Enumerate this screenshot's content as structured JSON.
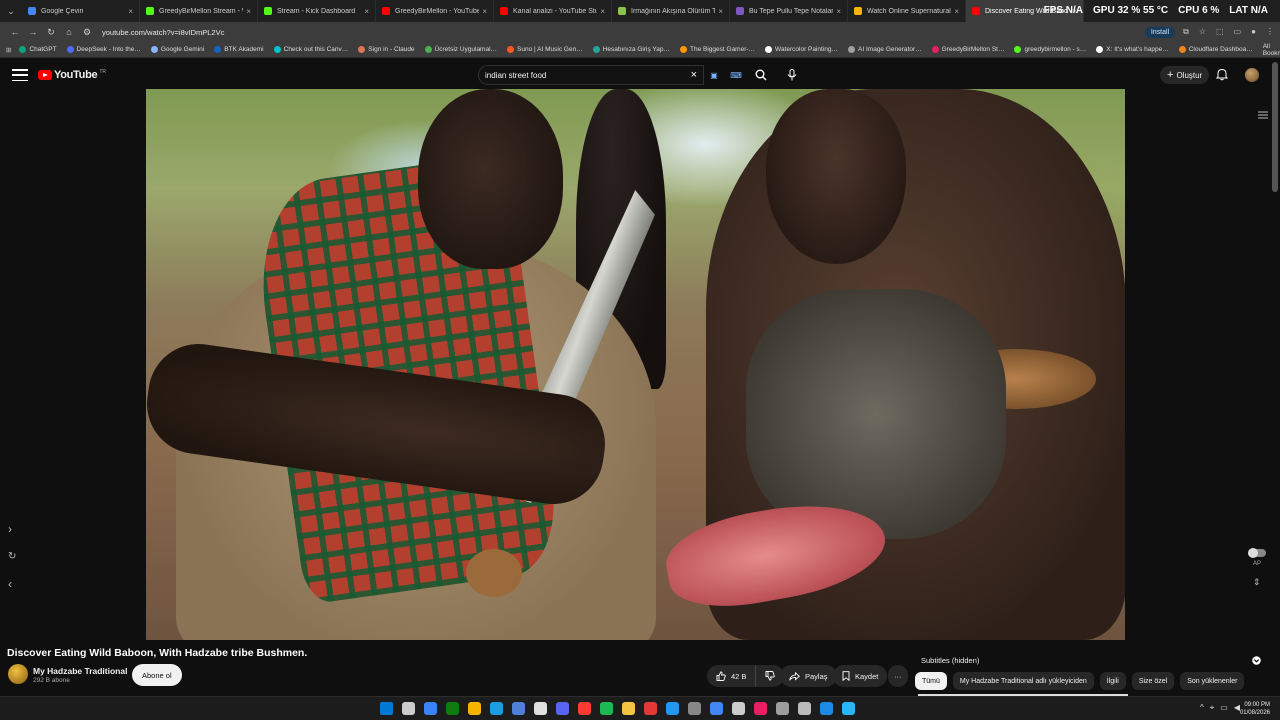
{
  "browser": {
    "tabs": [
      {
        "label": "Google Çeviri",
        "color": "#4285f4"
      },
      {
        "label": "GreedyBirMellon Stream - Wa…",
        "color": "#53fc18"
      },
      {
        "label": "Stream - Kick Dashboard",
        "color": "#53fc18"
      },
      {
        "label": "GreedyBirMellon - YouTube",
        "color": "#ff0000"
      },
      {
        "label": "Kanal analizi - YouTube Studio",
        "color": "#ff0000"
      },
      {
        "label": "Irmağının Akışına Ölürüm Türk…",
        "color": "#8bc34a"
      },
      {
        "label": "Bu Tepe Pullu Tepe Notaları | N…",
        "color": "#7e57c2"
      },
      {
        "label": "Watch Online Supernatural Se…",
        "color": "#f4b400"
      },
      {
        "label": "Discover Eating Wild Babo…",
        "color": "#ff0000",
        "active": true
      }
    ],
    "hud": {
      "fps": "FPS N/A",
      "gpu": "GPU 32 % 55 °C",
      "cpu": "CPU 6 %",
      "lat": "LAT N/A"
    },
    "url": "youtube.com/watch?v=i8vIDmPL2Vc",
    "install_label": "Install",
    "bookmarks": [
      {
        "label": "ChatGPT",
        "color": "#10a37f"
      },
      {
        "label": "DeepSeek - Into the…",
        "color": "#4d6bfe"
      },
      {
        "label": "Google Gemini",
        "color": "#8ab4f8"
      },
      {
        "label": "BTK Akademi",
        "color": "#1565c0"
      },
      {
        "label": "Check out this Canv…",
        "color": "#00c4cc"
      },
      {
        "label": "Sign in - Claude",
        "color": "#d97757"
      },
      {
        "label": "Ücretsiz Uygulamal…",
        "color": "#4caf50"
      },
      {
        "label": "Suno | AI Music Gen…",
        "color": "#ff5722"
      },
      {
        "label": "Hesabınıza Giriş Yap…",
        "color": "#26a69a"
      },
      {
        "label": "The Biggest Gamer-…",
        "color": "#ff9800"
      },
      {
        "label": "Watercolor Painting…",
        "color": "#ffffff"
      },
      {
        "label": "AI Image Generator…",
        "color": "#9e9e9e"
      },
      {
        "label": "GreedyBirMellon St…",
        "color": "#e91e63"
      },
      {
        "label": "greedybirmellon - s…",
        "color": "#53fc18"
      },
      {
        "label": "X: It's what's happe…",
        "color": "#ffffff"
      },
      {
        "label": "Cloudflare Dashboa…",
        "color": "#f48120"
      }
    ],
    "all_bookmarks_label": "All Bookmarks"
  },
  "youtube": {
    "logo_text": "YouTube",
    "country_code": "TR",
    "search_query": "indian street food",
    "create_label": "Oluştur"
  },
  "video": {
    "title": "Discover Eating Wild Baboon, With Hadzabe tribe Bushmen.",
    "channel_name": "My Hadzabe Traditional",
    "channel_subs": "292 B abone",
    "subscribe_label": "Abone ol",
    "likes": "42 B",
    "share_label": "Paylaş",
    "save_label": "Kaydet",
    "ap_label": "AP"
  },
  "side_panel": {
    "subtitles_label": "Subtitles (hidden)",
    "chips": [
      "Tümü",
      "My Hadzabe Traditional adlı yükleyiciden",
      "İlgili",
      "Size özel",
      "Son yüklenenler"
    ]
  },
  "taskbar": {
    "time": "09:00 PM",
    "date": "01/08/2026",
    "icon_colors": [
      "#0078d4",
      "#cccccc",
      "#3b82f6",
      "#107c10",
      "#f4b400",
      "#1b9de2",
      "#4f7fd9",
      "#e0e0e0",
      "#5865f2",
      "#ff3b30",
      "#1db954",
      "#f4c542",
      "#e53935",
      "#2196f3",
      "#888888",
      "#4285f4",
      "#cccccc",
      "#e91e63",
      "#9e9e9e",
      "#bbbbbb",
      "#1e88e5",
      "#29b6f6"
    ]
  }
}
